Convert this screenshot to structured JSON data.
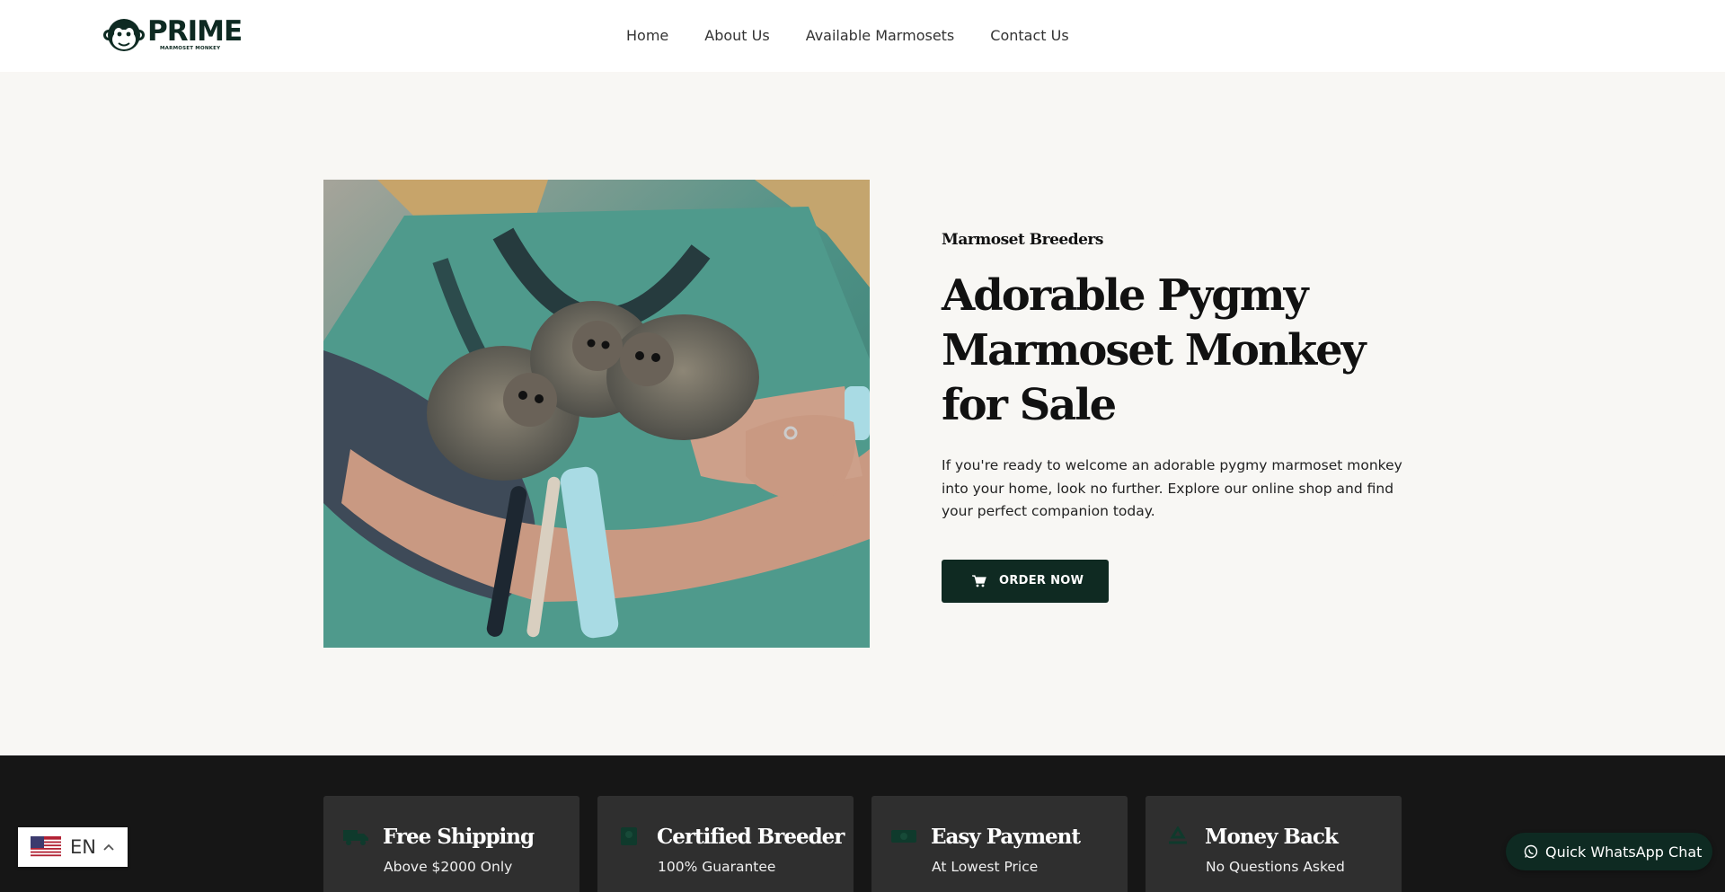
{
  "logo": {
    "word": "PRIME",
    "sub": "MARMOSET MONKEY"
  },
  "nav": {
    "items": [
      {
        "label": "Home"
      },
      {
        "label": "About Us"
      },
      {
        "label": "Available Marmosets"
      },
      {
        "label": "Contact Us"
      }
    ]
  },
  "hero": {
    "eyebrow": "Marmoset Breeders",
    "title": "Adorable Pygmy Marmoset Monkey for Sale",
    "description": "If you're ready to welcome an adorable pygmy marmoset monkey into your home, look no further. Explore our online shop and find your perfect companion today.",
    "order_label": "ORDER NOW",
    "order_icon": "cart-icon"
  },
  "features": [
    {
      "title": "Free Shipping",
      "subtitle": "Above $2000 Only",
      "icon": "truck-icon"
    },
    {
      "title": "Certified Breeder",
      "subtitle": "100% Guarantee",
      "icon": "certificate-icon"
    },
    {
      "title": "Easy Payment",
      "subtitle": "At Lowest Price",
      "icon": "money-icon"
    },
    {
      "title": "Money Back",
      "subtitle": "No Questions Asked",
      "icon": "recycle-icon"
    }
  ],
  "language": {
    "code": "EN",
    "flag": "us-flag-icon"
  },
  "whatsapp": {
    "label": "Quick WhatsApp Chat",
    "icon": "whatsapp-icon"
  },
  "colors": {
    "brand": "#0f2a22",
    "band": "#161616",
    "card": "#2f2f2f",
    "icon_green": "#0f3a2c"
  }
}
